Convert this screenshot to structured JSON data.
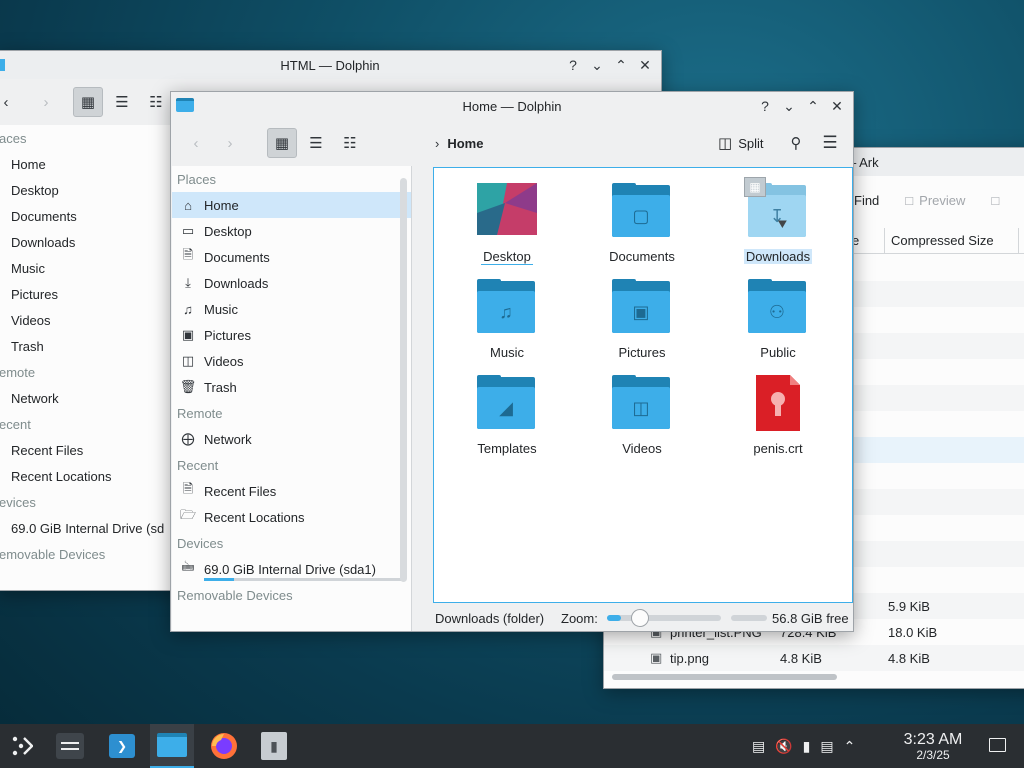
{
  "back_window": {
    "title": "HTML — Dolphin",
    "sidebar": {
      "places_label": "aces",
      "places": [
        "Home",
        "Desktop",
        "Documents",
        "Downloads",
        "Music",
        "Pictures",
        "Videos",
        "Trash"
      ],
      "remote_label": "emote",
      "remote": [
        "Network"
      ],
      "recent_label": "ecent",
      "recent": [
        "Recent Files",
        "Recent Locations"
      ],
      "devices_label": "evices",
      "drive": "69.0 GiB Internal Drive (sd",
      "removable": "emovable Devices"
    }
  },
  "ark_window": {
    "title": "HTML.zip — Ark",
    "toolbar": {
      "find": "Find",
      "preview": "Preview"
    },
    "columns": {
      "partial": "e",
      "compressed": "Compressed Size"
    },
    "rows": [
      {
        "name": "",
        "size": "",
        "compressed": "5.9 KiB"
      },
      {
        "name": "printer_list.PNG",
        "size": "728.4 KiB",
        "compressed": "18.0 KiB"
      },
      {
        "name": "tip.png",
        "size": "4.8 KiB",
        "compressed": "4.8 KiB"
      }
    ]
  },
  "main_window": {
    "title": "Home — Dolphin",
    "breadcrumb": "Home",
    "split_label": "Split",
    "sidebar": {
      "places_label": "Places",
      "places": [
        {
          "label": "Home",
          "icon": "home-icon"
        },
        {
          "label": "Desktop",
          "icon": "desktop-icon"
        },
        {
          "label": "Documents",
          "icon": "documents-icon"
        },
        {
          "label": "Downloads",
          "icon": "downloads-icon"
        },
        {
          "label": "Music",
          "icon": "music-icon"
        },
        {
          "label": "Pictures",
          "icon": "pictures-icon"
        },
        {
          "label": "Videos",
          "icon": "videos-icon"
        },
        {
          "label": "Trash",
          "icon": "trash-icon"
        }
      ],
      "remote_label": "Remote",
      "network": "Network",
      "recent_label": "Recent",
      "recent_files": "Recent Files",
      "recent_locations": "Recent Locations",
      "devices_label": "Devices",
      "drive": "69.0 GiB Internal Drive (sda1)",
      "removable_label": "Removable Devices"
    },
    "files": [
      {
        "name": "Desktop",
        "type": "desktop"
      },
      {
        "name": "Documents",
        "type": "folder"
      },
      {
        "name": "Downloads",
        "type": "folder"
      },
      {
        "name": "Music",
        "type": "folder"
      },
      {
        "name": "Pictures",
        "type": "folder"
      },
      {
        "name": "Public",
        "type": "folder"
      },
      {
        "name": "Templates",
        "type": "folder"
      },
      {
        "name": "Videos",
        "type": "folder"
      },
      {
        "name": "penis.crt",
        "type": "certificate"
      }
    ],
    "status": {
      "selection": "Downloads (folder)",
      "zoom_label": "Zoom:",
      "zoom_level": 0.1,
      "free_space": "56.8 GiB free"
    }
  },
  "taskbar": {
    "time": "3:23 AM",
    "date": "2/3/25"
  },
  "colors": {
    "accent": "#3daee9",
    "selection": "#cfe7fa",
    "taskbar": "#2a2e32"
  }
}
